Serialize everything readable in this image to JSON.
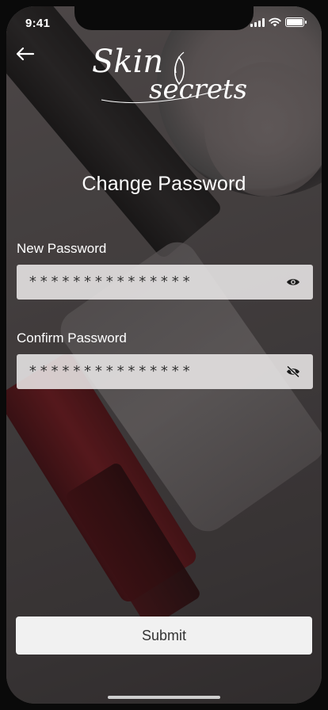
{
  "status_bar": {
    "time": "9:41"
  },
  "brand": {
    "line1": "Skin",
    "line2": "secrets",
    "trademark": "™"
  },
  "page": {
    "title": "Change Password"
  },
  "form": {
    "new_password": {
      "label": "New Password",
      "value": "***************",
      "visibility_icon": "eye-icon"
    },
    "confirm_password": {
      "label": "Confirm Password",
      "value": "***************",
      "visibility_icon": "eye-off-icon"
    },
    "submit_label": "Submit"
  },
  "colors": {
    "field_background": "#eeecec",
    "button_background": "#f1f1f1",
    "text_light": "#ffffff"
  }
}
